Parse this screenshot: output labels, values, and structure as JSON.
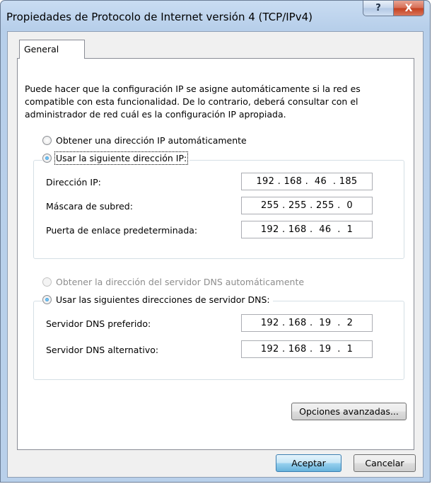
{
  "window": {
    "title": "Propiedades de Protocolo de Internet versión 4 (TCP/IPv4)",
    "help_icon": "?",
    "close_icon": "X"
  },
  "tabs": [
    "General"
  ],
  "description": "Puede hacer que la configuración IP se asigne automáticamente si la red es compatible con esta funcionalidad. De lo contrario, deberá consultar con el administrador de red cuál es la configuración IP apropiada.",
  "ip": {
    "auto_label": "Obtener una dirección IP automáticamente",
    "manual_label": "Usar la siguiente dirección IP:",
    "selected": "manual",
    "fields": [
      {
        "label": "Dirección IP:",
        "value": "192 . 168 .  46  . 185"
      },
      {
        "label": "Máscara de subred:",
        "value": "255 . 255 . 255 .  0"
      },
      {
        "label": "Puerta de enlace predeterminada:",
        "value": "192 . 168 .  46  .  1"
      }
    ]
  },
  "dns": {
    "auto_label": "Obtener la dirección del servidor DNS automáticamente",
    "manual_label": "Usar las siguientes direcciones de servidor DNS:",
    "selected": "manual",
    "fields": [
      {
        "label": "Servidor DNS preferido:",
        "value": "192 . 168 .  19  .  2"
      },
      {
        "label": "Servidor DNS alternativo:",
        "value": "192 . 168 .  19  .  1"
      }
    ]
  },
  "buttons": {
    "advanced": "Opciones avanzadas...",
    "ok": "Aceptar",
    "cancel": "Cancelar"
  }
}
